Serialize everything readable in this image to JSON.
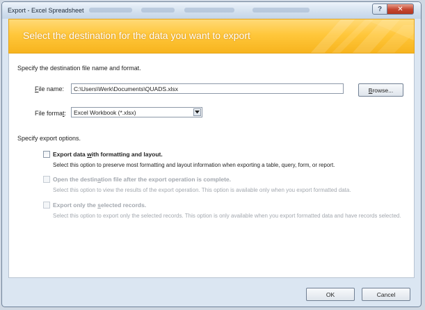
{
  "window": {
    "title": "Export - Excel Spreadsheet"
  },
  "banner": {
    "text": "Select the destination for the data you want to export"
  },
  "destination": {
    "section_label": "Specify the destination file name and format.",
    "file_name_label": "File name:",
    "file_name_value": "C:\\Users\\Werk\\Documents\\QUADS.xlsx",
    "browse_label": "Browse...",
    "file_format_label": "File format:",
    "file_format_value": "Excel Workbook (*.xlsx)"
  },
  "options": {
    "section_label": "Specify export options.",
    "items": [
      {
        "title": "Export data with formatting and layout.",
        "description": "Select this option to preserve most formatting and layout information when exporting a table, query, form, or report.",
        "checked": false,
        "enabled": true
      },
      {
        "title": "Open the destination file after the export operation is complete.",
        "description": "Select this option to view the results of the export operation. This option is available only when you export formatted data.",
        "checked": false,
        "enabled": false
      },
      {
        "title": "Export only the selected records.",
        "description": "Select this option to export only the selected records. This option is only available when you export formatted data and have records selected.",
        "checked": false,
        "enabled": false
      }
    ]
  },
  "footer": {
    "ok_label": "OK",
    "cancel_label": "Cancel"
  },
  "icons": {
    "help": "help-icon",
    "close": "close-icon",
    "dropdown": "chevron-down-icon"
  },
  "colors": {
    "banner": "#ffc73b",
    "banner_text": "#ffffff",
    "close_button": "#c5452f",
    "disabled_text": "#a2a7ae"
  }
}
